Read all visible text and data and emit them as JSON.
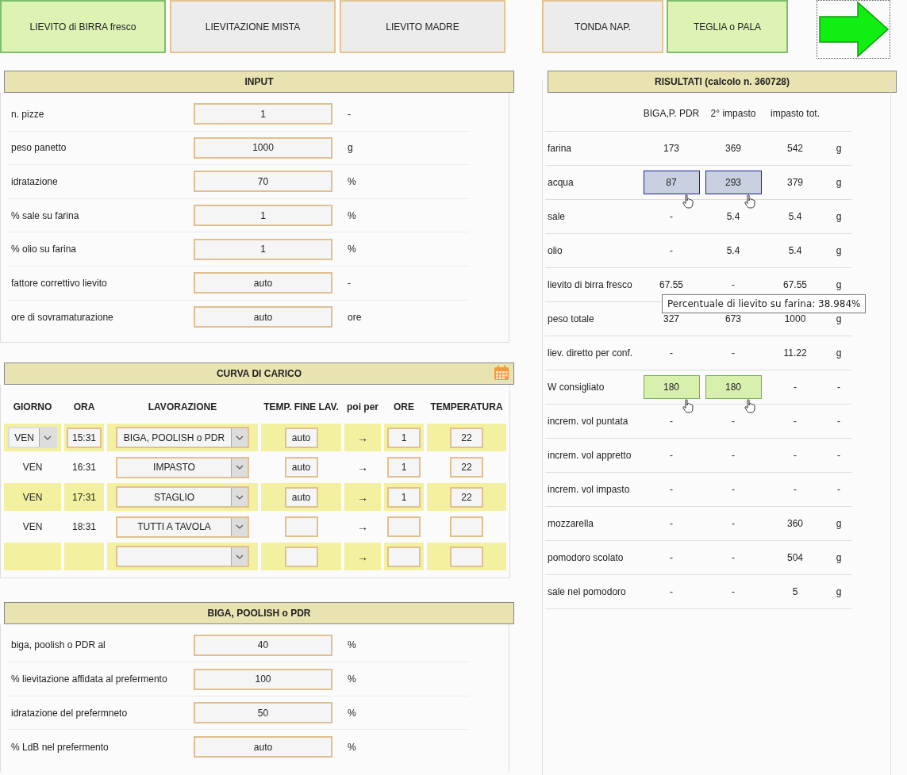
{
  "mode_tabs": [
    {
      "label": "LIEVITO di BIRRA fresco",
      "selected": true
    },
    {
      "label": "LIEVITAZIONE MISTA",
      "selected": false
    },
    {
      "label": "LIEVITO MADRE",
      "selected": false
    }
  ],
  "shape_tabs": [
    {
      "label": "TONDA NAP.",
      "selected": false
    },
    {
      "label": "TEGLIA o PALA",
      "selected": true
    }
  ],
  "input": {
    "title": "INPUT",
    "rows": [
      {
        "label": "n. pizze",
        "value": "1",
        "unit": "-"
      },
      {
        "label": "peso panetto",
        "value": "1000",
        "unit": "g"
      },
      {
        "label": "idratazione",
        "value": "70",
        "unit": "%"
      },
      {
        "label": "% sale su farina",
        "value": "1",
        "unit": "%"
      },
      {
        "label": "% olio su farina",
        "value": "1",
        "unit": "%"
      },
      {
        "label": "fattore correttivo lievito",
        "value": "auto",
        "unit": "-"
      },
      {
        "label": "ore di sovramaturazione",
        "value": "auto",
        "unit": "ore"
      }
    ]
  },
  "curve": {
    "title": "CURVA DI CARICO",
    "columns": [
      "GIORNO",
      "ORA",
      "LAVORAZIONE",
      "TEMP. FINE LAV.",
      "poi per",
      "ORE",
      "TEMPERATURA"
    ],
    "rows": [
      {
        "editable": true,
        "day": "VEN",
        "time": "15:31",
        "step": "BIGA, POOLISH o PDR",
        "end_temp": "auto",
        "arrow": "→",
        "hours": "1",
        "temperature": "22"
      },
      {
        "editable": false,
        "day": "VEN",
        "time": "16:31",
        "step": "IMPASTO",
        "end_temp": "auto",
        "arrow": "→",
        "hours": "1",
        "temperature": "22"
      },
      {
        "editable": false,
        "day": "VEN",
        "time": "17:31",
        "step": "STAGLIO",
        "end_temp": "auto",
        "arrow": "→",
        "hours": "1",
        "temperature": "22"
      },
      {
        "editable": false,
        "day": "VEN",
        "time": "18:31",
        "step": "TUTTI A TAVOLA",
        "arrow": "→"
      },
      {
        "editable": false,
        "arrow": "→"
      }
    ]
  },
  "biga": {
    "title": "BIGA, POOLISH o PDR",
    "rows": [
      {
        "label": "biga, poolish o PDR al",
        "value": "40",
        "unit": "%"
      },
      {
        "label": "% lievitazione affidata al prefermento",
        "value": "100",
        "unit": "%"
      },
      {
        "label": "idratazione del prefermneto",
        "value": "50",
        "unit": "%"
      },
      {
        "label": "% LdB nel prefermento",
        "value": "auto",
        "unit": "%"
      }
    ]
  },
  "results": {
    "title": "RISULTATI (calcolo n. 360728)",
    "columns": [
      "BIGA,P. PDR",
      "2° impasto",
      "impasto tot."
    ],
    "rows": [
      {
        "label": "farina",
        "kind": "plain",
        "values": [
          "173",
          "369",
          "542"
        ],
        "unit": "g"
      },
      {
        "label": "acqua",
        "kind": "adjust",
        "values": [
          "87",
          "293",
          "379"
        ],
        "unit": "g"
      },
      {
        "label": "sale",
        "kind": "plain",
        "values": [
          "-",
          "5.4",
          "5.4"
        ],
        "unit": "g"
      },
      {
        "label": "olio",
        "kind": "plain",
        "values": [
          "-",
          "5.4",
          "5.4"
        ],
        "unit": "g"
      },
      {
        "label": "lievito di birra fresco",
        "kind": "plain",
        "values": [
          "67.55",
          "-",
          "67.55"
        ],
        "unit": "g"
      },
      {
        "label": "peso totale",
        "kind": "plain",
        "values": [
          "327",
          "673",
          "1000"
        ],
        "unit": "g"
      },
      {
        "label": "liev. diretto per conf.",
        "kind": "plain",
        "values": [
          "-",
          "-",
          "11.22"
        ],
        "unit": "g"
      },
      {
        "label": "W consigliato",
        "kind": "suggest",
        "values": [
          "180",
          "180",
          "-"
        ],
        "unit": "-"
      },
      {
        "label": "increm. vol puntata",
        "kind": "plain",
        "values": [
          "-",
          "-",
          "-"
        ],
        "unit": "-"
      },
      {
        "label": "increm. vol appretto",
        "kind": "plain",
        "values": [
          "-",
          "-",
          "-"
        ],
        "unit": "-"
      },
      {
        "label": "increm. vol impasto",
        "kind": "plain",
        "values": [
          "-",
          "-",
          "-"
        ],
        "unit": "-"
      },
      {
        "label": "mozzarella",
        "kind": "plain",
        "values": [
          "-",
          "-",
          "360"
        ],
        "unit": "g"
      },
      {
        "label": "pomodoro scolato",
        "kind": "plain",
        "values": [
          "-",
          "-",
          "504"
        ],
        "unit": "g"
      },
      {
        "label": "sale nel pomodoro",
        "kind": "plain",
        "values": [
          "-",
          "-",
          "5"
        ],
        "unit": "g"
      }
    ],
    "tooltip": "Percentuale di lievito su farina: 38.984%"
  }
}
